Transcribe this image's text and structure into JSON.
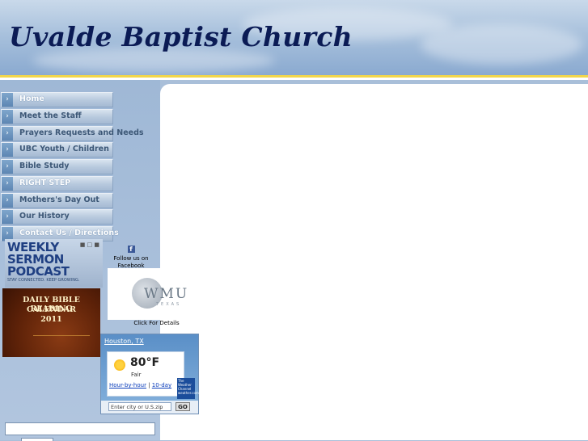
{
  "header": {
    "title": "Uvalde Baptist Church"
  },
  "nav": {
    "items": [
      {
        "label": "Home"
      },
      {
        "label": "Meet the Staff"
      },
      {
        "label": "Prayers Requests and Needs"
      },
      {
        "label": "UBC Youth / Children"
      },
      {
        "label": "Bible Study"
      },
      {
        "label": "RIGHT STEP"
      },
      {
        "label": "Mothers's Day Out"
      },
      {
        "label": "Our History"
      },
      {
        "label": "Contact Us / Directions"
      }
    ]
  },
  "podcast": {
    "line1": "WEEKLY",
    "line2": "SERMON",
    "line3": "PODCAST",
    "tagline": "STAY CONNECTED. KEEP GROWING."
  },
  "calendar": {
    "line1": "DAILY BIBLE READING",
    "line2": "CALENDAR",
    "line3": "2011"
  },
  "facebook": {
    "icon": "facebook-icon",
    "text": "Follow us on Facebook"
  },
  "wmu": {
    "letters": "WMU",
    "sub": "TEXAS",
    "caption": "Click For Details"
  },
  "weather": {
    "city": "Houston, TX",
    "temp": "80°F",
    "condition": "Fair",
    "link_hourly": "Hour-by-hour",
    "separator": "|",
    "link_10day": "10-day",
    "search_placeholder": "Enter city or U.S.zip",
    "go_label": "GO",
    "brand": "The Weather Channel weather.com"
  },
  "colors": {
    "title": "#0b1b55",
    "accent_line": "#f2d64a",
    "sidebar": "#a9bfd9"
  }
}
